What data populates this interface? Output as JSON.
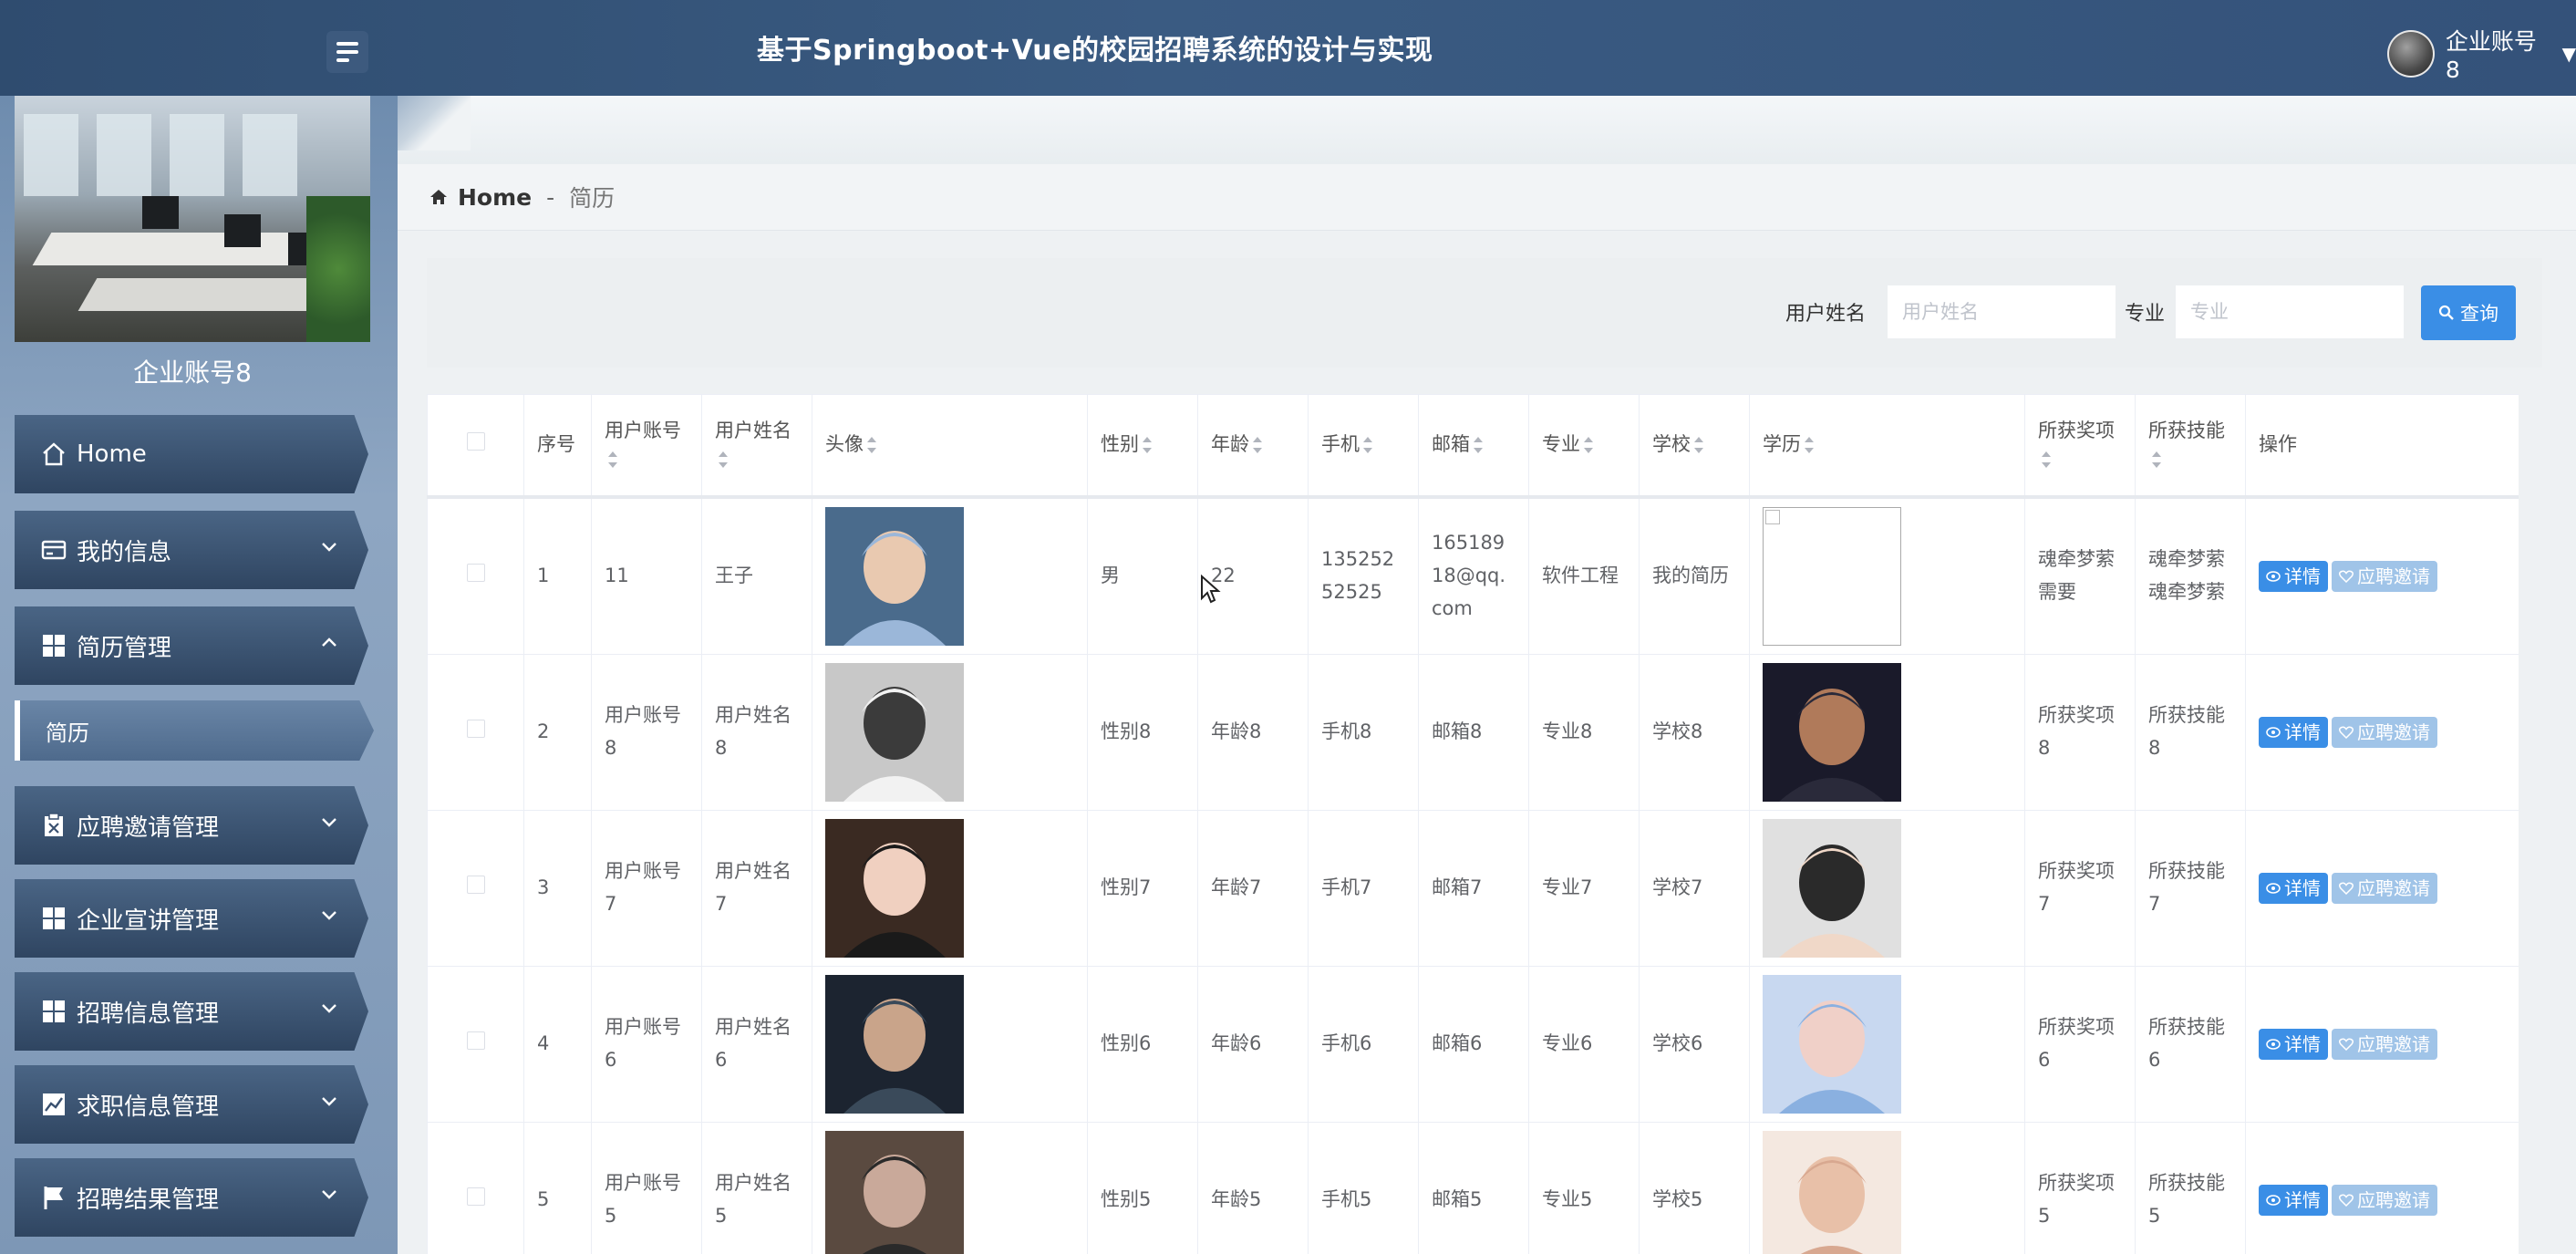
{
  "header": {
    "title": "基于Springboot+Vue的校园招聘系统的设计与实现",
    "user": "企业账号8"
  },
  "sidebar": {
    "profile_name": "企业账号8",
    "items": [
      {
        "label": "Home",
        "icon": "home-icon"
      },
      {
        "label": "我的信息",
        "icon": "card-icon"
      },
      {
        "label": "简历管理",
        "icon": "grid-icon",
        "expanded": true
      },
      {
        "label": "应聘邀请管理",
        "icon": "clipboard-icon"
      },
      {
        "label": "企业宣讲管理",
        "icon": "grid-icon"
      },
      {
        "label": "招聘信息管理",
        "icon": "grid-icon"
      },
      {
        "label": "求职信息管理",
        "icon": "chart-icon"
      },
      {
        "label": "招聘结果管理",
        "icon": "flag-icon"
      }
    ],
    "sub_item": "简历"
  },
  "breadcrumb": {
    "home": "Home",
    "separator": "-",
    "current": "简历"
  },
  "search": {
    "name_label": "用户姓名",
    "name_placeholder": "用户姓名",
    "major_label": "专业",
    "major_placeholder": "专业",
    "query_button": "查询"
  },
  "table": {
    "headers": [
      "序号",
      "用户账号",
      "用户姓名",
      "头像",
      "性别",
      "年龄",
      "手机",
      "邮箱",
      "专业",
      "学校",
      "学历",
      "所获奖项",
      "所获技能",
      "操作"
    ],
    "actions": {
      "detail": "详情",
      "invite": "应聘邀请"
    },
    "rows": [
      {
        "index": "1",
        "account": "11",
        "name": "王子",
        "gender": "男",
        "age": "22",
        "phone": "13525252525",
        "email": "16518918@qq.com",
        "major": "软件工程",
        "school": "我的简历",
        "awards": "魂牵梦萦需要",
        "skills": "魂牵梦萦魂牵梦萦"
      },
      {
        "index": "2",
        "account": "用户账号8",
        "name": "用户姓名8",
        "gender": "性别8",
        "age": "年龄8",
        "phone": "手机8",
        "email": "邮箱8",
        "major": "专业8",
        "school": "学校8",
        "awards": "所获奖项8",
        "skills": "所获技能8"
      },
      {
        "index": "3",
        "account": "用户账号7",
        "name": "用户姓名7",
        "gender": "性别7",
        "age": "年龄7",
        "phone": "手机7",
        "email": "邮箱7",
        "major": "专业7",
        "school": "学校7",
        "awards": "所获奖项7",
        "skills": "所获技能7"
      },
      {
        "index": "4",
        "account": "用户账号6",
        "name": "用户姓名6",
        "gender": "性别6",
        "age": "年龄6",
        "phone": "手机6",
        "email": "邮箱6",
        "major": "专业6",
        "school": "学校6",
        "awards": "所获奖项6",
        "skills": "所获技能6"
      },
      {
        "index": "5",
        "account": "用户账号5",
        "name": "用户姓名5",
        "gender": "性别5",
        "age": "年龄5",
        "phone": "手机5",
        "email": "邮箱5",
        "major": "专业5",
        "school": "学校5",
        "awards": "所获奖项5",
        "skills": "所获技能5"
      }
    ]
  },
  "colors": {
    "header": "#34527a",
    "sidebar": "#7d97b6",
    "nav_item": "#3a5170",
    "primary": "#3a8ee6",
    "invite": "#a0c4e8"
  }
}
